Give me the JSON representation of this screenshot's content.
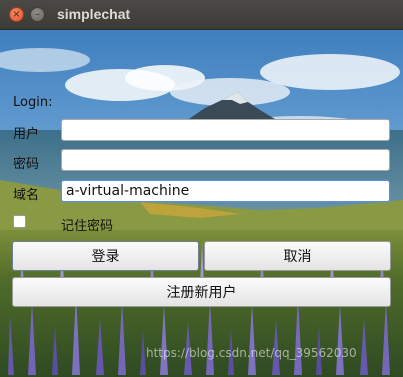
{
  "window": {
    "title": "simplechat",
    "close_glyph": "×",
    "minimize_glyph": "–"
  },
  "form": {
    "heading": "Login:",
    "username_label": "用户",
    "username_value": "",
    "password_label": "密码",
    "password_value": "",
    "domain_label": "域名",
    "domain_value": "a-virtual-machine",
    "remember_label": "记住密码",
    "remember_checked": false
  },
  "buttons": {
    "login": "登录",
    "cancel": "取消",
    "register": "注册新用户"
  },
  "watermark": "https://blog.csdn.net/qq_39562030",
  "colors": {
    "titlebar": "#3c3b37",
    "close_button": "#e95420",
    "focus_border": "#5b8fd8"
  }
}
